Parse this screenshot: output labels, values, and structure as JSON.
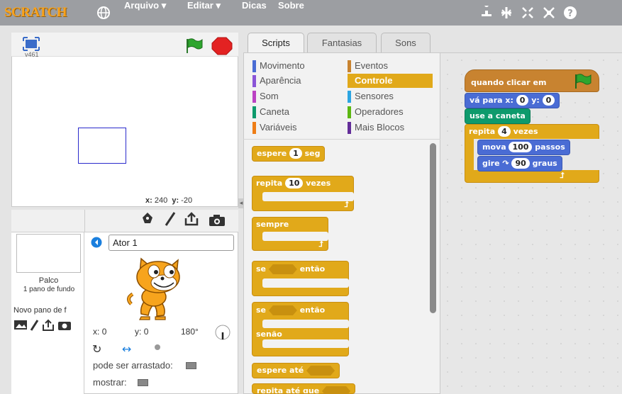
{
  "menubar": {
    "logo": "SCRATCH",
    "file": "Arquivo ▾",
    "edit": "Editar ▾",
    "tips": "Dicas",
    "about": "Sobre"
  },
  "stage": {
    "version": "v461",
    "coords_x_label": "x:",
    "coords_x": "240",
    "coords_y_label": "y:",
    "coords_y": "-20"
  },
  "tabs": {
    "scripts": "Scripts",
    "costumes": "Fantasias",
    "sounds": "Sons"
  },
  "categories": [
    {
      "label": "Movimento",
      "color": "#4a6cd4"
    },
    {
      "label": "Aparência",
      "color": "#8a55d7"
    },
    {
      "label": "Som",
      "color": "#bb42c3"
    },
    {
      "label": "Caneta",
      "color": "#0e9a6c"
    },
    {
      "label": "Variáveis",
      "color": "#ee7d16"
    },
    {
      "label": "Eventos",
      "color": "#c88330"
    },
    {
      "label": "Controle",
      "color": "#e1a91a"
    },
    {
      "label": "Sensores",
      "color": "#2ca5e2"
    },
    {
      "label": "Operadores",
      "color": "#5cb712"
    },
    {
      "label": "Mais Blocos",
      "color": "#632d99"
    }
  ],
  "palette": {
    "wait": "espere",
    "wait_val": "1",
    "wait_unit": "seg",
    "repeat": "repita",
    "repeat_val": "10",
    "repeat_unit": "vezes",
    "forever": "sempre",
    "if": "se",
    "then": "então",
    "if2": "se",
    "then2": "então",
    "else": "senão",
    "wait_until": "espere até",
    "repeat_until": "repita até que"
  },
  "script": {
    "hat": "quando clicar em",
    "goto": "vá para x:",
    "goto_x": "0",
    "goto_y_label": "y:",
    "goto_y": "0",
    "pen_down": "use a caneta",
    "repeat": "repita",
    "repeat_val": "4",
    "repeat_unit": "vezes",
    "move": "mova",
    "move_val": "100",
    "move_unit": "passos",
    "turn": "gire",
    "turn_val": "90",
    "turn_unit": "graus"
  },
  "sprite_panel": {
    "stage_label": "Palco",
    "backdrop_count": "1 pano de fundo",
    "new_backdrop": "Novo pano de f",
    "sprite_name": "Ator 1",
    "x_label": "x:",
    "x_val": "0",
    "y_label": "y:",
    "y_val": "0",
    "direction": "180°",
    "draggable": "pode ser arrastado:",
    "show": "mostrar:"
  }
}
